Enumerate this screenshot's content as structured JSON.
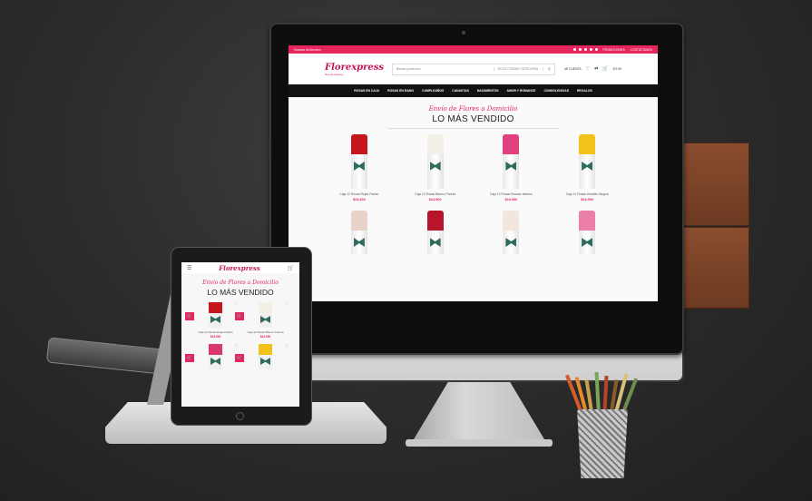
{
  "desktop": {
    "topbar": {
      "left_text": "Horarios de Atención",
      "promo": "PROMOCIONES",
      "contact": "CONTÁCTANOS"
    },
    "logo": {
      "name": "Florexpress",
      "tagline": "florería delivery"
    },
    "search": {
      "placeholder": "Buscar productos",
      "category": "SELECCIONAR CATEGORÍA"
    },
    "account": "MI CUENTA",
    "cart_total": "$ 0.00",
    "nav": [
      "ROSAS EN CAJA",
      "ROSAS EN RAMO",
      "CUMPLEAÑOS",
      "CANASTAS",
      "NACIMIENTOS",
      "AMOR Y ROMANCE",
      "CONDOLENCIAS",
      "REGALOS"
    ],
    "hero_subtitle": "Envío de Flores a Domicilio",
    "hero_title": "LO MÁS VENDIDO",
    "products": [
      {
        "name": "Caja 12 Rosas Rojas Pasión",
        "price": "$24.900",
        "color": "#c4161c"
      },
      {
        "name": "Caja 12 Rosas Blanco Pureza",
        "price": "$24.900",
        "color": "#f1efe6"
      },
      {
        "name": "Caja 12 Rosas Rosado Intenso",
        "price": "$24.900",
        "color": "#e0417e"
      },
      {
        "name": "Caja 12 Rosas Amarillo Alegría",
        "price": "$24.900",
        "color": "#f2c21b"
      },
      {
        "name": "",
        "price": "",
        "color": "#e9d3c8"
      },
      {
        "name": "",
        "price": "",
        "color": "#b8142a"
      },
      {
        "name": "",
        "price": "",
        "color": "#f3e6df"
      },
      {
        "name": "",
        "price": "",
        "color": "#ec7fa8"
      }
    ]
  },
  "tablet": {
    "logo": "Florexpress",
    "hero_subtitle": "Envío de Flores a Domicilio",
    "hero_title": "LO MÁS VENDIDO",
    "products": [
      {
        "name": "Caja 12 Rosas Rojas Pasión",
        "price": "$24.900",
        "color": "#c4161c"
      },
      {
        "name": "Caja 12 Rosas Blanco Pureza",
        "price": "$24.900",
        "color": "#f1efe6"
      },
      {
        "name": "",
        "price": "",
        "color": "#d9376e"
      },
      {
        "name": "",
        "price": "",
        "color": "#f2c21b"
      }
    ]
  },
  "colors": {
    "brand": "#e5255b",
    "nav_bg": "#111111"
  }
}
